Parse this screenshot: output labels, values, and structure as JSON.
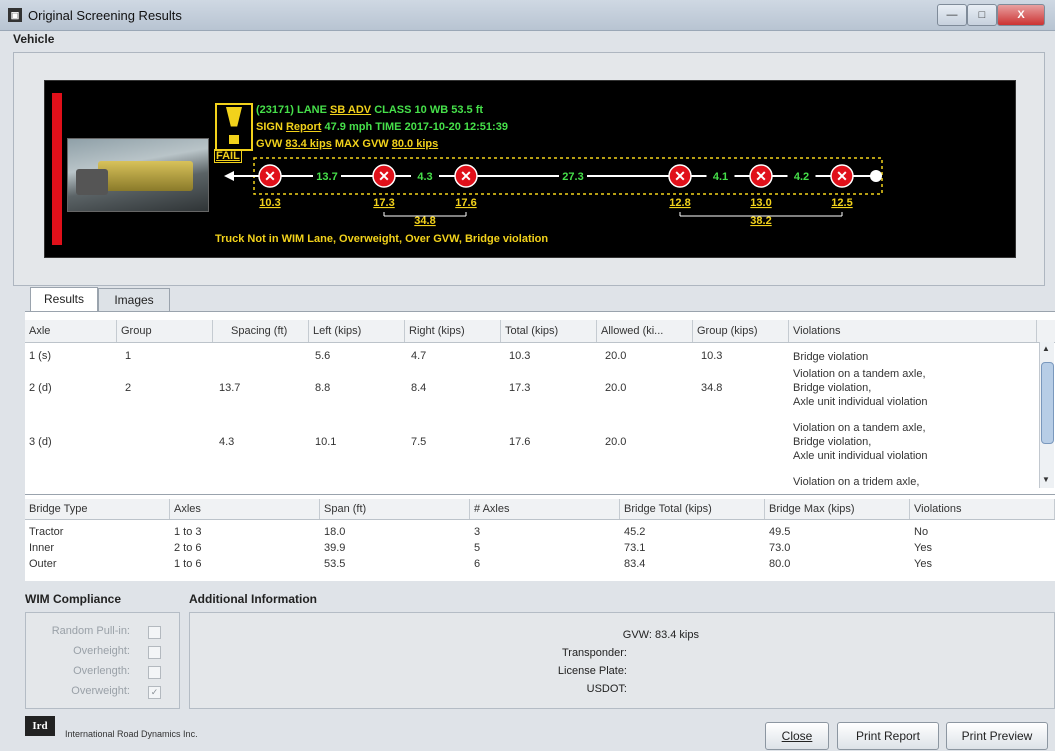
{
  "window": {
    "title": "Original Screening Results",
    "icon": "app-icon",
    "min": "—",
    "max": "□",
    "close": "X"
  },
  "vehicle": {
    "section_label": "Vehicle",
    "lane_line": {
      "id": "(23171) LANE",
      "lane": "SB ADV",
      "class_label": "CLASS",
      "class_value": "10",
      "wb_label": "WB",
      "wb_value": "53.5 ft"
    },
    "sign_line": {
      "sign_label": "SIGN",
      "sign_value": "Report",
      "speed": "47.9 mph",
      "time_label": "TIME",
      "time_value": "2017-10-20 12:51:39"
    },
    "gvw_line": {
      "gvw_label": "GVW",
      "gvw_value": "83.4 kips",
      "max_label": "MAX GVW",
      "max_value": "80.0 kips"
    },
    "status": "FAIL",
    "spacings": [
      "13.7",
      "4.3",
      "27.3",
      "4.1",
      "4.2"
    ],
    "axle_weights": [
      "10.3",
      "17.3",
      "17.6",
      "12.8",
      "13.0",
      "12.5"
    ],
    "group_weights": [
      "34.8",
      "38.2"
    ],
    "message": "Truck Not in WIM Lane, Overweight, Over GVW, Bridge violation"
  },
  "tabs": [
    {
      "label": "Results"
    },
    {
      "label": "Images"
    }
  ],
  "results": {
    "columns": [
      "Axle",
      "Group",
      "Spacing (ft)",
      "Left (kips)",
      "Right (kips)",
      "Total (kips)",
      "Allowed (ki...",
      "Group (kips)",
      "Violations"
    ],
    "rows": [
      {
        "axle": "1 (s)",
        "group": "1",
        "spacing": "",
        "left": "5.6",
        "right": "4.7",
        "total": "10.3",
        "allowed": "20.0",
        "group_kips": "10.3",
        "violations": [
          "Bridge violation"
        ]
      },
      {
        "axle": "2 (d)",
        "group": "2",
        "spacing": "13.7",
        "left": "8.8",
        "right": "8.4",
        "total": "17.3",
        "allowed": "20.0",
        "group_kips": "34.8",
        "violations": [
          "Violation on a tandem axle,",
          "Bridge violation,",
          "Axle unit individual violation"
        ]
      },
      {
        "axle": "3 (d)",
        "group": "",
        "spacing": "4.3",
        "left": "10.1",
        "right": "7.5",
        "total": "17.6",
        "allowed": "20.0",
        "group_kips": "",
        "violations": [
          "Violation on a tandem axle,",
          "Bridge violation,",
          "Axle unit individual violation"
        ]
      },
      {
        "axle": "",
        "group": "",
        "spacing": "",
        "left": "",
        "right": "",
        "total": "",
        "allowed": "",
        "group_kips": "",
        "violations": [
          "Violation on a tridem axle,"
        ]
      }
    ]
  },
  "bridge": {
    "columns": [
      "Bridge Type",
      "Axles",
      "Span (ft)",
      "# Axles",
      "Bridge Total (kips)",
      "Bridge Max (kips)",
      "Violations"
    ],
    "rows": [
      {
        "type": "Tractor",
        "axles": "1 to 3",
        "span": "18.0",
        "count": "3",
        "total": "45.2",
        "max": "49.5",
        "violations": "No"
      },
      {
        "type": "Inner",
        "axles": "2 to 6",
        "span": "39.9",
        "count": "5",
        "total": "73.1",
        "max": "73.0",
        "violations": "Yes"
      },
      {
        "type": "Outer",
        "axles": "1 to 6",
        "span": "53.5",
        "count": "6",
        "total": "83.4",
        "max": "80.0",
        "violations": "Yes"
      }
    ]
  },
  "wim": {
    "title": "WIM Compliance",
    "items": [
      {
        "label": "Random Pull-in:",
        "checked": false
      },
      {
        "label": "Overheight:",
        "checked": false
      },
      {
        "label": "Overlength:",
        "checked": false
      },
      {
        "label": "Overweight:",
        "checked": true
      }
    ]
  },
  "additional": {
    "title": "Additional Information",
    "gvw": "GVW: 83.4 kips",
    "transponder": "Transponder:",
    "license": "License Plate:",
    "usdot": "USDOT:"
  },
  "footer": {
    "logo": "Ird",
    "company": "International Road Dynamics Inc.",
    "close": "Close",
    "print_report": "Print Report",
    "print_preview": "Print Preview"
  },
  "colors": {
    "fail": "#e0101a",
    "yellow": "#f2d21b",
    "green": "#46e04a"
  }
}
